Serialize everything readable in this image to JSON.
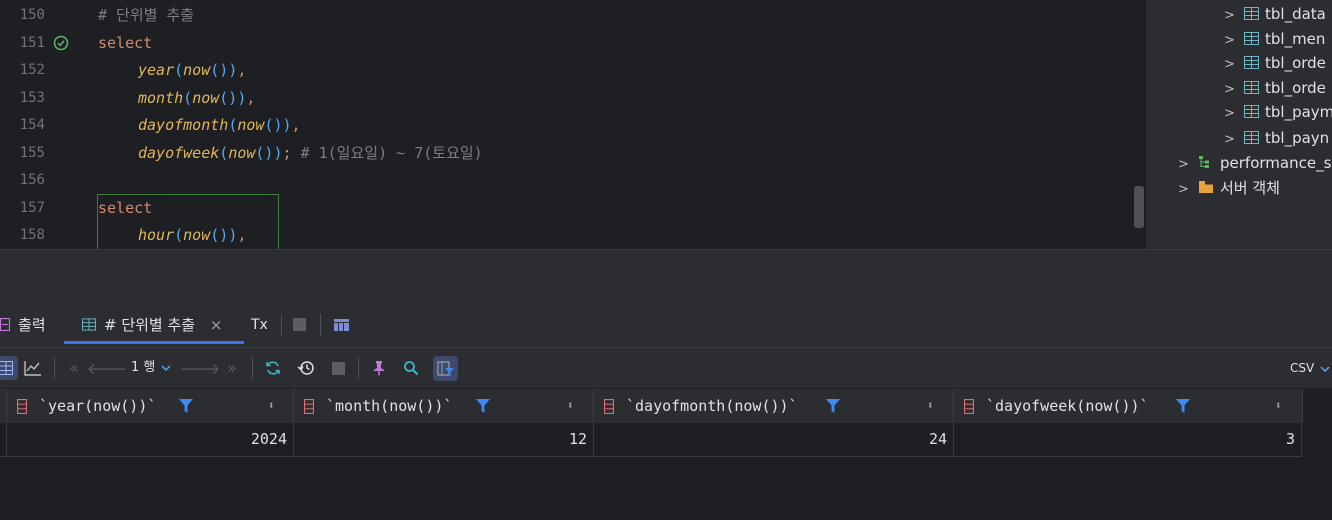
{
  "editor": {
    "lines": [
      {
        "num": "150",
        "text": "# 단위별 추출"
      },
      {
        "num": "151",
        "text": "select"
      },
      {
        "num": "152",
        "fn": "year",
        "arg": "now",
        "tail": ","
      },
      {
        "num": "153",
        "fn": "month",
        "arg": "now",
        "tail": ","
      },
      {
        "num": "154",
        "fn": "dayofmonth",
        "arg": "now",
        "tail": ","
      },
      {
        "num": "155",
        "fn": "dayofweek",
        "arg": "now",
        "tail": ";",
        "comment": "# 1(일요일) ~ 7(토요일)"
      },
      {
        "num": "156",
        "text": ""
      },
      {
        "num": "157",
        "text": "select"
      },
      {
        "num": "158",
        "fn": "hour",
        "arg": "now",
        "tail": ","
      }
    ],
    "paren_open": "(",
    "paren_close": ")",
    "call_parens": "()",
    "check_icon": "check-circle-icon"
  },
  "tree": {
    "tables": [
      "tbl_data",
      "tbl_men",
      "tbl_orde",
      "tbl_orde",
      "tbl_paym",
      "tbl_payn"
    ],
    "schema": "performance_s",
    "server_objects": "서버 객체"
  },
  "results": {
    "tabs": {
      "output": "출력",
      "query": "# 단위별 추출",
      "close": "×",
      "tx": "Tx"
    },
    "toolbar": {
      "page": "1 행",
      "export": "CSV"
    },
    "columns": [
      "`year(now())`",
      "`month(now())`",
      "`dayofmonth(now())`",
      "`dayofweek(now())`"
    ],
    "rows": [
      [
        "2024",
        "12",
        "24",
        "3"
      ]
    ]
  },
  "colors": {
    "accent": "#3574f0",
    "keyword": "#cf8e6d",
    "function": "#e0b55c",
    "paren": "#56a8f5",
    "comment": "#7a7e85",
    "table_icon": "#6fb5c4",
    "column_icon": "#e06c75",
    "filter": "#3d8af7"
  }
}
